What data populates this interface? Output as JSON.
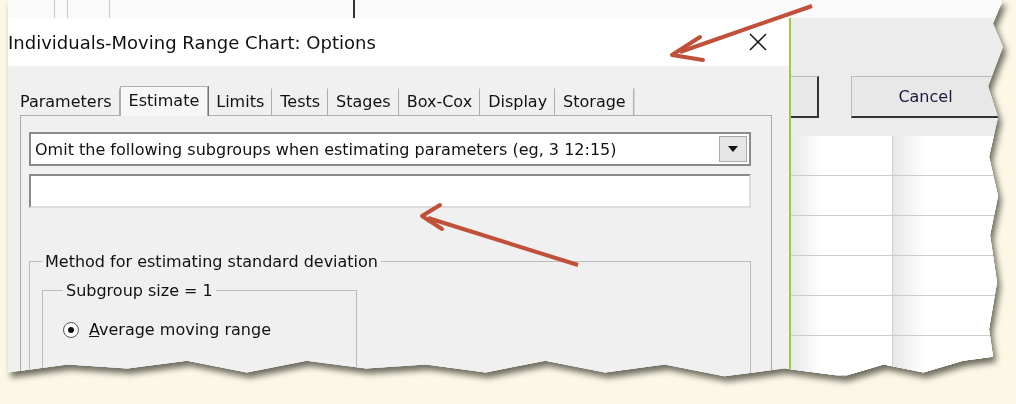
{
  "dialog": {
    "title": "Individuals-Moving Range Chart: Options",
    "tabs": [
      {
        "label": "Parameters",
        "selected": false
      },
      {
        "label": "Estimate",
        "selected": true
      },
      {
        "label": "Limits",
        "selected": false
      },
      {
        "label": "Tests",
        "selected": false
      },
      {
        "label": "Stages",
        "selected": false
      },
      {
        "label": "Box-Cox",
        "selected": false
      },
      {
        "label": "Display",
        "selected": false
      },
      {
        "label": "Storage",
        "selected": false
      }
    ],
    "dropdown": {
      "value": "Omit the following subgroups when estimating parameters (eg, 3 12:15)"
    },
    "method_group": {
      "title": "Method for estimating standard deviation",
      "subgroup": {
        "title": "Subgroup size = 1",
        "options": [
          {
            "label": "Average moving range",
            "selected": true
          }
        ]
      }
    }
  },
  "background_window": {
    "buttons": [
      "Cancel"
    ]
  }
}
